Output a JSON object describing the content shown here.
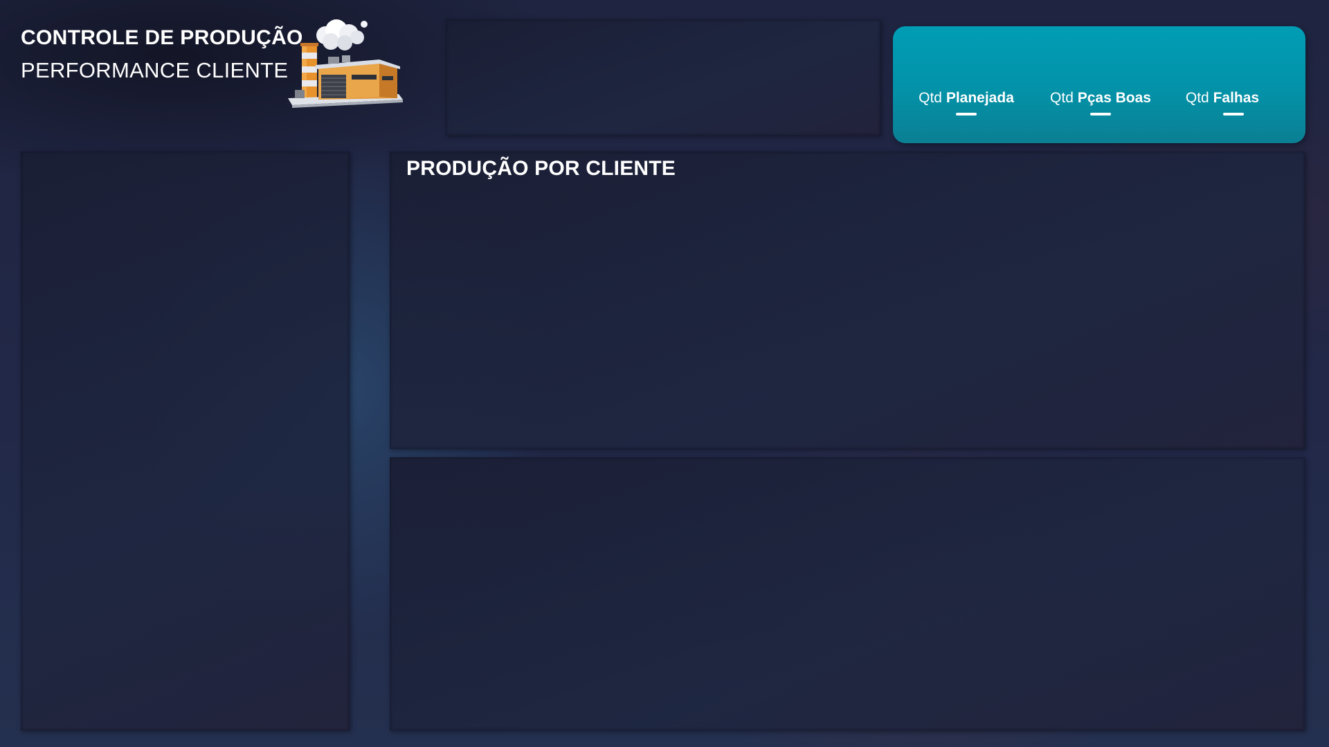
{
  "header": {
    "title": "CONTROLE DE PRODUÇÃO",
    "subtitle": "PERFORMANCE CLIENTE",
    "illustration_icon": "factory-icon"
  },
  "kpis": [
    {
      "prefix": "Qtd",
      "label": "Planejada",
      "value": "—"
    },
    {
      "prefix": "Qtd",
      "label": "Pças Boas",
      "value": "—"
    },
    {
      "prefix": "Qtd",
      "label": "Falhas",
      "value": "—"
    }
  ],
  "panels": {
    "clientes_title": "PRODUÇÃO POR CLIENTE"
  },
  "colors": {
    "background": "#222848",
    "panel": "#1e2440",
    "kpi_card": "#009db5",
    "factory_orange": "#e8922e"
  }
}
